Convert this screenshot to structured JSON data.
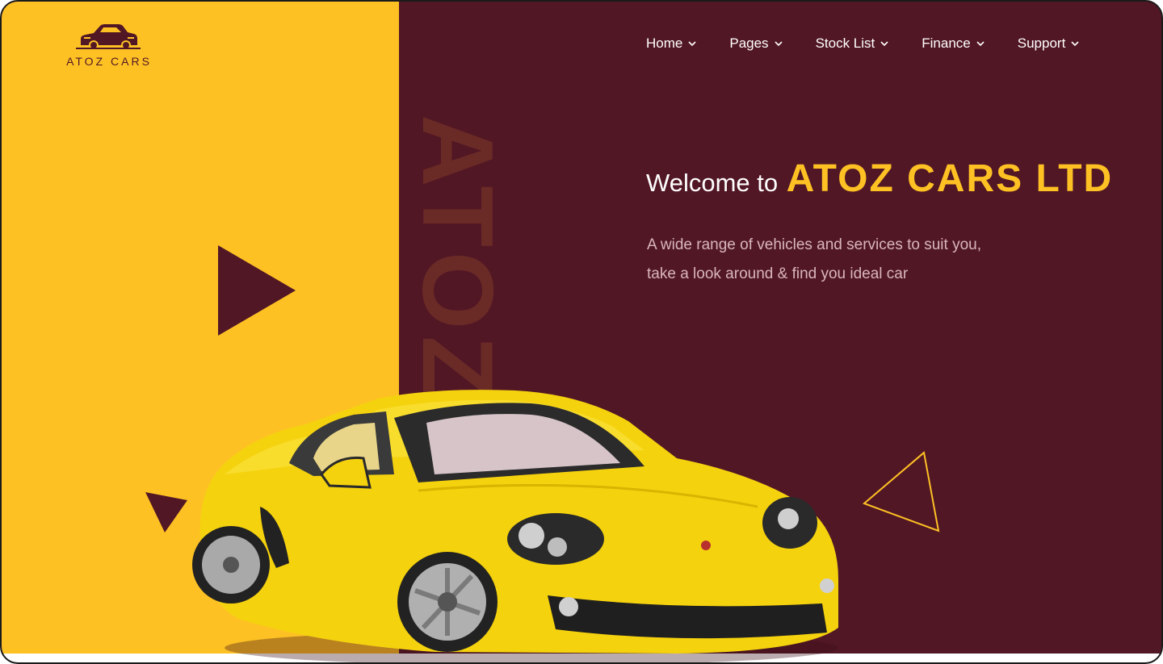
{
  "brand": {
    "logo_text": "ATOZ CARS",
    "logo_icon": "car-icon"
  },
  "nav": {
    "items": [
      {
        "label": "Home"
      },
      {
        "label": "Pages"
      },
      {
        "label": "Stock List"
      },
      {
        "label": "Finance"
      },
      {
        "label": "Support"
      }
    ],
    "dropdown_icon": "chevron-down-icon"
  },
  "hero": {
    "watermark": "ATOZ",
    "welcome": "Welcome to",
    "brand_name": "ATOZ CARS LTD",
    "line1": "A wide range of vehicles and services to suit you,",
    "line2": "take a look around & find you ideal car",
    "image": "yellow-sports-car"
  },
  "colors": {
    "accent_yellow": "#fec124",
    "dark_maroon": "#521725",
    "text_muted": "#d9b6bc"
  }
}
